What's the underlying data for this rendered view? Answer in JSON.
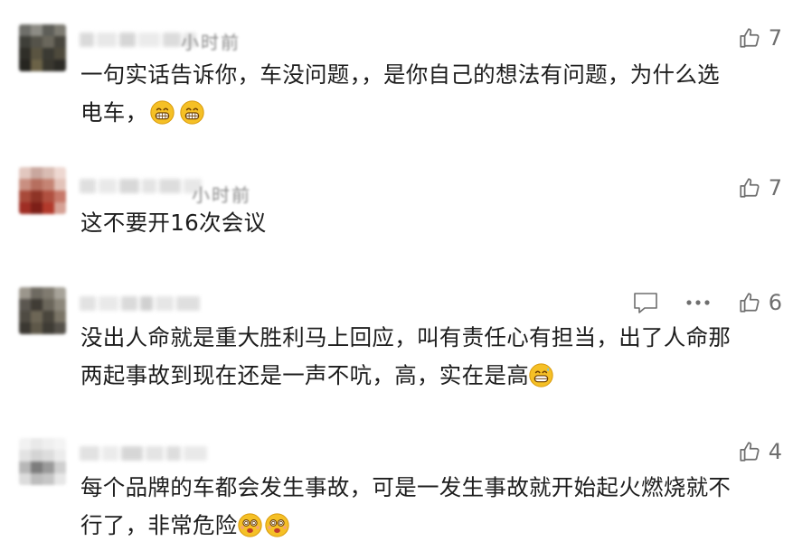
{
  "comments": [
    {
      "time": "小时前",
      "likes": "7",
      "text_lines": [
        "一句实话告诉你，车没问题，，是你自己的想法有问题，为什么选",
        "电车，"
      ],
      "emojis": [
        "grin-icon",
        "grin-icon"
      ]
    },
    {
      "time": "小时前",
      "likes": "7",
      "text_lines": [
        "这不要开16次会议"
      ],
      "emojis": []
    },
    {
      "likes": "6",
      "text_lines": [
        "没出人命就是重大胜利马上回应，叫有责任心有担当，出了人命那",
        "两起事故到现在还是一声不吭，高，实在是高"
      ],
      "emojis": [
        "grin-sweat-icon"
      ]
    },
    {
      "likes": "4",
      "text_lines": [
        "每个品牌的车都会发生事故，可是一发生事故就开始起火燃烧就不",
        "行了，非常危险"
      ],
      "emojis": [
        "dizzy-face-icon",
        "dizzy-face-icon"
      ]
    }
  ],
  "icons": {
    "like": "thumbs-up-icon",
    "reply": "comment-icon",
    "more": "more-icon"
  },
  "colors": {
    "icon_gray": "#6e6e6e",
    "emoji_yellow": "#f5c026"
  }
}
